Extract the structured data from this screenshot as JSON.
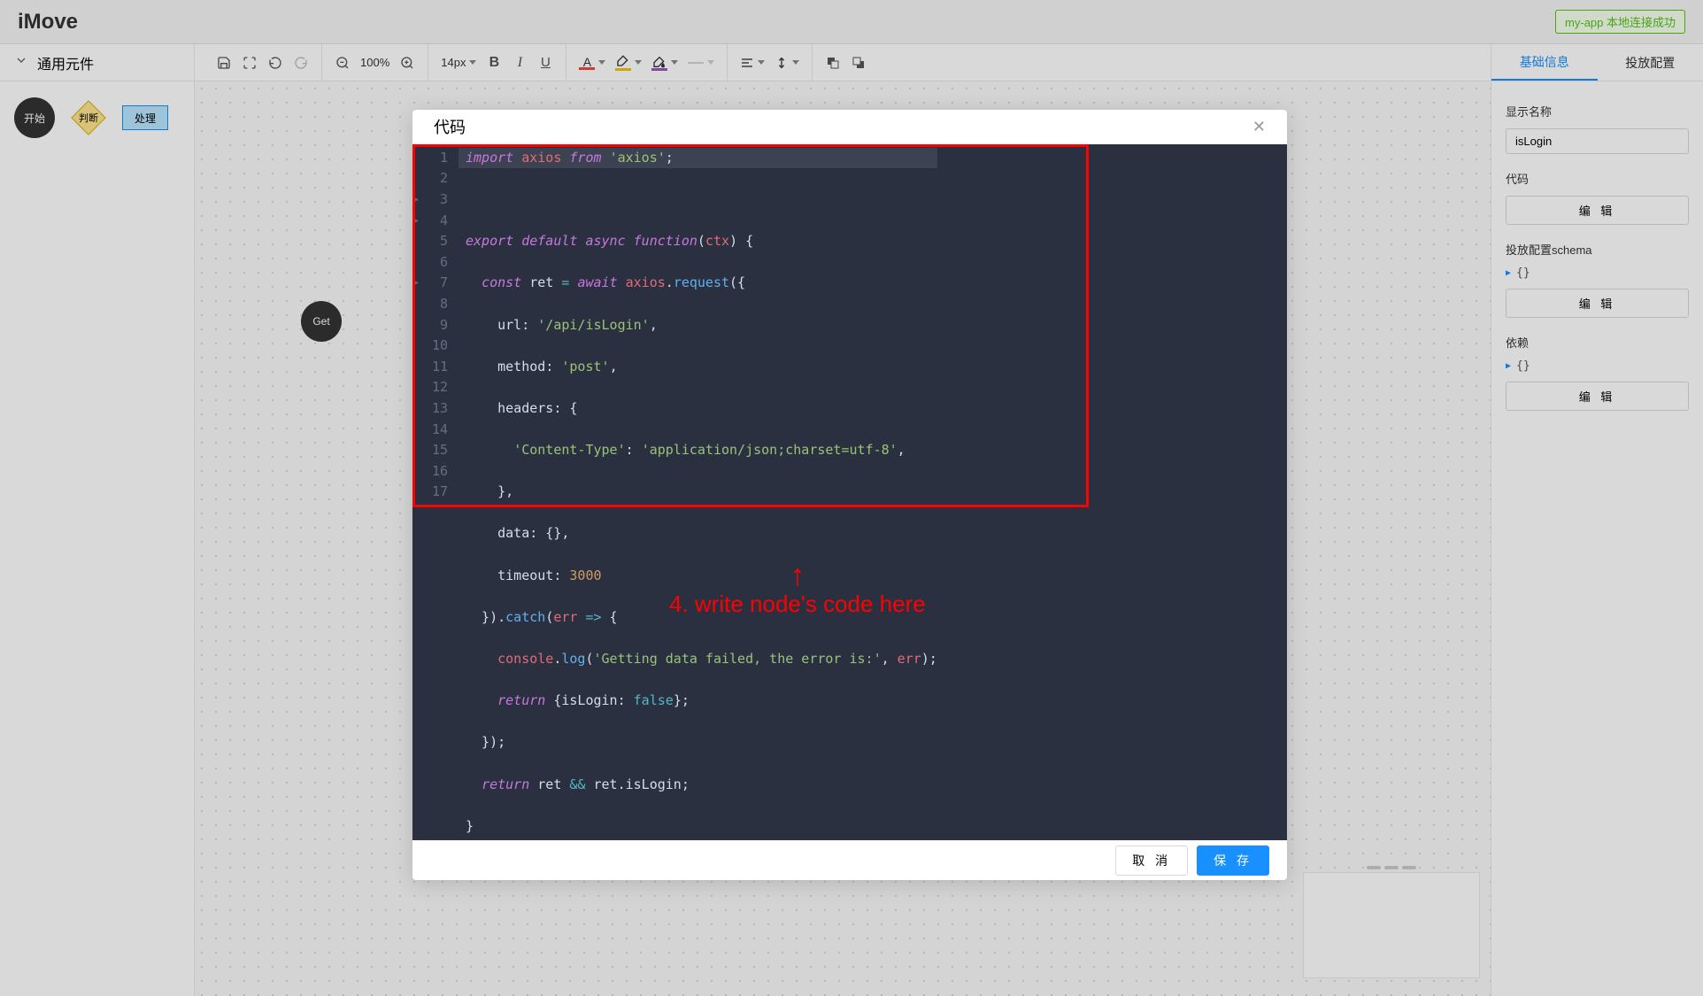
{
  "app": {
    "name": "iMove"
  },
  "connection": {
    "status": "my-app 本地连接成功"
  },
  "toolbar": {
    "zoom": "100%",
    "fontSize": "14px"
  },
  "sidebar": {
    "section": "通用元件",
    "nodes": {
      "start": "开始",
      "decision": "判断",
      "process": "处理"
    }
  },
  "canvas": {
    "node": "Get"
  },
  "rightPanel": {
    "tabs": {
      "basic": "基础信息",
      "deploy": "投放配置"
    },
    "displayName": {
      "label": "显示名称",
      "value": "isLogin"
    },
    "code": {
      "label": "代码",
      "button": "编 辑"
    },
    "schema": {
      "label": "投放配置schema",
      "preview": "{}",
      "button": "编 辑"
    },
    "deps": {
      "label": "依赖",
      "preview": "{}",
      "button": "编 辑"
    }
  },
  "modal": {
    "title": "代码",
    "cancel": "取 消",
    "save": "保 存",
    "annotation": "4. write node's code here",
    "code": {
      "lines": 17,
      "source": "import axios from 'axios';\n\nexport default async function(ctx) {\n  const ret = await axios.request({\n    url: '/api/isLogin',\n    method: 'post',\n    headers: {\n      'Content-Type': 'application/json;charset=utf-8',\n    },\n    data: {},\n    timeout: 3000\n  }).catch(err => {\n    console.log('Getting data failed, the error is:', err);\n    return {isLogin: false};\n  });\n  return ret && ret.isLogin;\n}"
    }
  }
}
